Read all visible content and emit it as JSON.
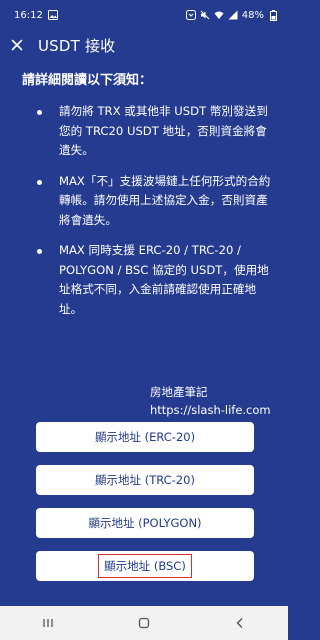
{
  "status_bar": {
    "time": "16:12",
    "battery": "48%",
    "icons": [
      "image-icon",
      "samsung-icon",
      "silent-icon",
      "wifi-icon",
      "signal-icon",
      "battery-icon"
    ]
  },
  "header": {
    "title": "USDT 接收",
    "close_icon": "close-icon"
  },
  "notice": {
    "heading": "請詳細閱讀以下須知：",
    "items": [
      "請勿將 TRX 或其他非 USDT 幣別發送到您的 TRC20 USDT 地址，否則資金將會遺失。",
      "MAX「不」支援波場鏈上任何形式的合約轉帳。請勿使用上述協定入金，否則資產將會遺失。",
      "MAX 同時支援 ERC-20 / TRC-20 / POLYGON / BSC 協定的 USDT，使用地址格式不同，入金前請確認使用正確地址。"
    ]
  },
  "watermark": {
    "line1": "房地產筆記",
    "line2": "https://slash-life.com"
  },
  "buttons": {
    "erc20": "顯示地址 (ERC-20)",
    "trc20": "顯示地址 (TRC-20)",
    "polygon": "顯示地址 (POLYGON)",
    "bsc": "顯示地址 (BSC)"
  },
  "colors": {
    "background": "#253b8f",
    "button_text": "#233a8a",
    "highlight": "#d8302b"
  },
  "nav_bar": {
    "icons": [
      "recent-apps-icon",
      "home-icon",
      "back-icon"
    ]
  }
}
